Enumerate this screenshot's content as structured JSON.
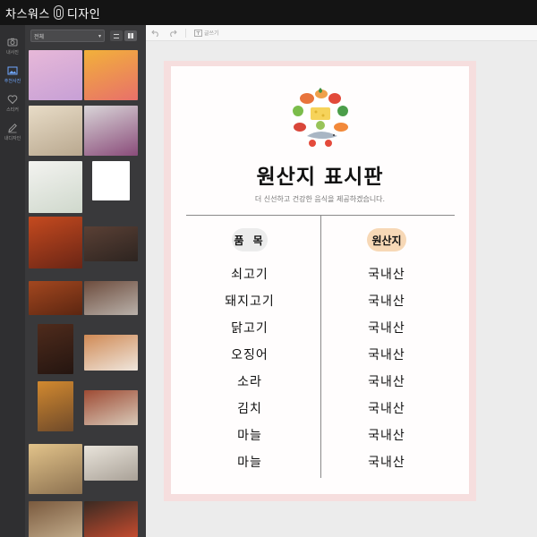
{
  "app": {
    "title": "차스워스 디자인"
  },
  "rail": {
    "items": [
      {
        "label": "내사진",
        "icon": "camera-icon",
        "active": false
      },
      {
        "label": "추천사진",
        "icon": "image-icon",
        "active": true
      },
      {
        "label": "스티커",
        "icon": "heart-icon",
        "active": false
      },
      {
        "label": "내디자인",
        "icon": "pencil-icon",
        "active": false
      }
    ]
  },
  "panel": {
    "filter_value": "전체",
    "thumbnails": [
      {
        "name": "macarons",
        "colors": [
          "#e7b8d8",
          "#c7a0d6"
        ]
      },
      {
        "name": "layered-drink",
        "colors": [
          "#f2b13a",
          "#e8706a"
        ]
      },
      {
        "name": "dalgona-coffee",
        "colors": [
          "#e8dcc7",
          "#b9a88f"
        ]
      },
      {
        "name": "berry-smoothie",
        "colors": [
          "#d9d5d8",
          "#8a4c7a"
        ]
      },
      {
        "name": "lemon-water",
        "colors": [
          "#f3f3f0",
          "#cfd8cc"
        ]
      },
      {
        "name": "blank",
        "colors": [
          "#ffffff",
          "#ffffff"
        ]
      },
      {
        "name": "kimchi-stew",
        "colors": [
          "#c54a1f",
          "#6a2515"
        ]
      },
      {
        "name": "braised-dish",
        "colors": [
          "#5a4035",
          "#2d2420"
        ]
      },
      {
        "name": "fried-chicken",
        "colors": [
          "#a3471f",
          "#5c2611"
        ]
      },
      {
        "name": "grilled-meat",
        "colors": [
          "#6d4c3d",
          "#b9b1aa"
        ]
      },
      {
        "name": "steak",
        "colors": [
          "#4f2b1c",
          "#241510"
        ]
      },
      {
        "name": "grilled-fish",
        "colors": [
          "#d08a55",
          "#efe6dd"
        ]
      },
      {
        "name": "beer",
        "colors": [
          "#d2892f",
          "#6f4a2a"
        ]
      },
      {
        "name": "noodles",
        "colors": [
          "#9e4b34",
          "#d8c9b8"
        ]
      },
      {
        "name": "soup",
        "colors": [
          "#e2c38a",
          "#8c7150"
        ]
      },
      {
        "name": "dumpling-soup",
        "colors": [
          "#e9e4db",
          "#a9a197"
        ]
      },
      {
        "name": "rice-soup",
        "colors": [
          "#7a5a3e",
          "#d7c3a1"
        ]
      },
      {
        "name": "lunchbox",
        "colors": [
          "#3a2a22",
          "#c44b2f"
        ]
      }
    ]
  },
  "toolbar": {
    "undo_icon": "undo-icon",
    "redo_icon": "redo-icon",
    "text_label": "글쓰기"
  },
  "poster": {
    "title": "원산지 표시판",
    "subtitle": "더 신선하고 건강한 음식을 제공하겠습니다.",
    "col_item": "품 목",
    "col_origin": "원산지",
    "rows": [
      {
        "item": "쇠고기",
        "origin": "국내산"
      },
      {
        "item": "돼지고기",
        "origin": "국내산"
      },
      {
        "item": "닭고기",
        "origin": "국내산"
      },
      {
        "item": "오징어",
        "origin": "국내산"
      },
      {
        "item": "소라",
        "origin": "국내산"
      },
      {
        "item": "김치",
        "origin": "국내산"
      },
      {
        "item": "마늘",
        "origin": "국내산"
      },
      {
        "item": "마늘",
        "origin": "국내산"
      }
    ]
  }
}
